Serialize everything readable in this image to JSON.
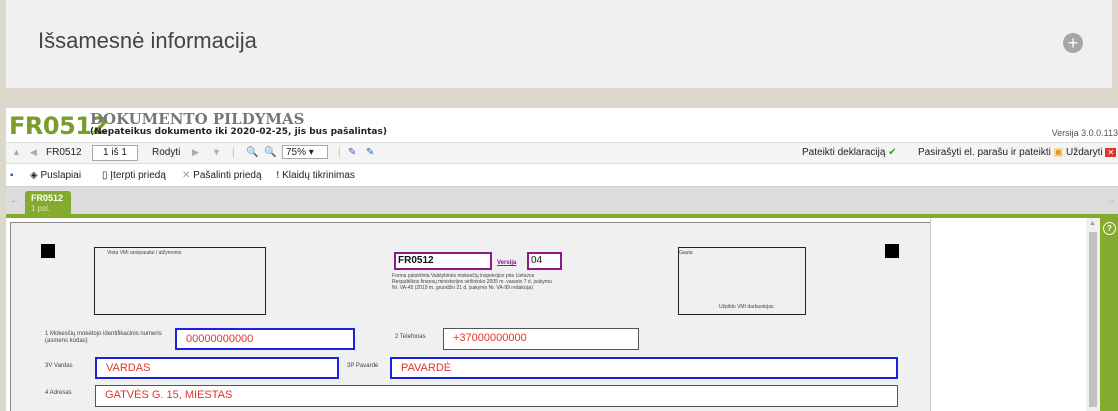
{
  "info_panel": {
    "title": "Išsamesnė informacija"
  },
  "header": {
    "code": "FR0512",
    "title": "DOKUMENTO PILDYMAS",
    "subtitle": "(Nepateikus dokumento iki 2020-02-25, jis bus pašalintas)",
    "version": "Versija 3.0.0.113"
  },
  "toolbar": {
    "form_code": "FR0512",
    "page_value": "1 iš 1",
    "show_label": "Rodyti",
    "zoom_value": "75%",
    "submit_label": "Pateikti deklaraciją",
    "sign_submit_label": "Pasirašyti el. parašu ir pateikti",
    "close_label": "Uždaryti"
  },
  "toolbar2": {
    "pages_label": "Puslapiai",
    "insert_label": "Įterpti priedą",
    "remove_label": "Pašalinti priedą",
    "errors_label": "Klaidų tikrinimas"
  },
  "tab": {
    "label": "FR0512",
    "sublabel": "1 psl."
  },
  "form": {
    "vmi_note": "Vieta VMI antspaudui / atžymoms",
    "form_code": "FR0512",
    "version_label": "Versija",
    "version_value": "04",
    "form_desc": "Forma patvirtinta Valstybinės mokesčių inspekcijos prie Lietuvos Respublikos finansų ministerijos viršininko 2005 m. vasario 7 d. įsakymu Nr. VA-45 (2019 m. gruodžio 21 d. įsakymo Nr. VA-99 redakcija)",
    "reg_label": "Gauta",
    "reg_footer": "Užpildo VMI darbuotojas",
    "f1_label": "1 Mokesčių mokėtojo identifikacinis numeris (asmens kodas)",
    "f1_value": "00000000000",
    "f2_label": "2 Telefonas",
    "f2_value": "+37000000000",
    "f3_label": "3V Vardas",
    "f3_value": "VARDAS",
    "f3p_label": "3P Pavardė",
    "f3p_value": "PAVARDĖ",
    "f4_label": "4 Adresas",
    "f4_value": "GATVĖS G. 15, MIESTAS"
  },
  "colors": {
    "accent": "#84ab2e",
    "field_text": "#e0352b",
    "field_border_blue": "#1a22e0",
    "field_border_purple": "#8a1a8c"
  }
}
